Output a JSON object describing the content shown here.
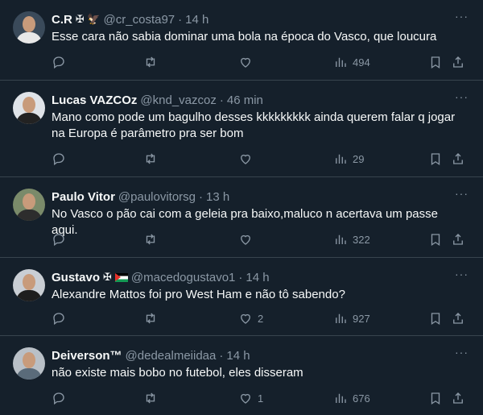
{
  "tweets": [
    {
      "name": "C.R",
      "badge": "✠ 🦅",
      "handle": "@cr_costa97",
      "dot": "·",
      "time": "14 h",
      "text": "Esse cara não sabia dominar uma bola na época do Vasco, que loucura",
      "replies": "",
      "retweets": "",
      "likes": "",
      "views": "494",
      "avatar_color": "#3a4a5a",
      "shirt_color": "#e8e8e8"
    },
    {
      "name": "Lucas VAZCOz",
      "badge": "",
      "handle": "@knd_vazcoz",
      "dot": "·",
      "time": "46 min",
      "text": "Mano como pode um bagulho desses kkkkkkkkk ainda querem falar q jogar na Europa é parâmetro pra ser bom",
      "replies": "",
      "retweets": "",
      "likes": "",
      "views": "29",
      "avatar_color": "#dfe3e8",
      "shirt_color": "#222222"
    },
    {
      "name": "Paulo Vitor",
      "badge": "",
      "handle": "@paulovitorsg",
      "dot": "·",
      "time": "13 h",
      "text": "No Vasco o pão cai com a geleia pra baixo,maluco n acertava um passe aqui.",
      "replies": "",
      "retweets": "",
      "likes": "",
      "views": "322",
      "avatar_color": "#7a8a6a",
      "shirt_color": "#2d2d2d"
    },
    {
      "name": "Gustavo",
      "badge": "✠",
      "handle": "@macedogustavo1",
      "dot": "·",
      "time": "14 h",
      "text": "Alexandre Mattos foi pro West Ham e não tô sabendo?",
      "replies": "",
      "retweets": "",
      "likes": "2",
      "views": "927",
      "avatar_color": "#c9ced4",
      "shirt_color": "#1e1e1e"
    },
    {
      "name": "Deiverson™",
      "badge": "",
      "handle": "@dedealmeiidaa",
      "dot": "·",
      "time": "14 h",
      "text": "não existe mais bobo no futebol, eles disseram",
      "replies": "",
      "retweets": "",
      "likes": "1",
      "views": "676",
      "avatar_color": "#b9c0c7",
      "shirt_color": "#5a6b7a"
    }
  ],
  "more_label": "···",
  "icons": [
    "reply-icon",
    "retweet-icon",
    "like-icon",
    "views-icon",
    "bookmark-icon",
    "share-icon"
  ]
}
